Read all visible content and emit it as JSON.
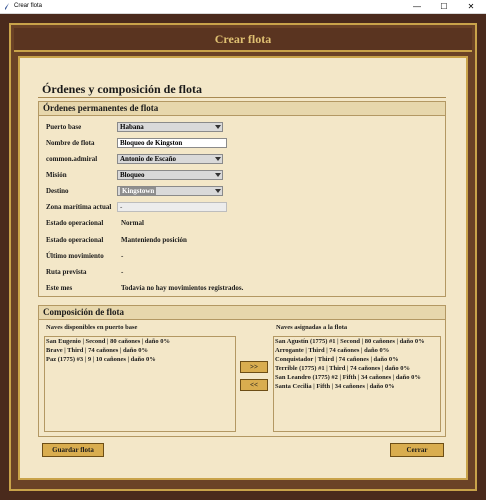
{
  "window": {
    "title": "Crear flota",
    "controls": [
      "—",
      "☐",
      "✕"
    ]
  },
  "header": {
    "title": "Crear flota"
  },
  "main": {
    "title": "Órdenes y composición de flota"
  },
  "orders": {
    "heading": "Órdenes permanentes de flota",
    "fields": {
      "home_port": {
        "label": "Puerto base",
        "value": "Habana"
      },
      "fleet_name": {
        "label": "Nombre de flota",
        "value": "Bloqueo de Kingston"
      },
      "admiral": {
        "label": "common.admiral",
        "value": "Antonio de Escaño"
      },
      "mission": {
        "label": "Misión",
        "value": "Bloqueo"
      },
      "destination": {
        "label": "Destino",
        "value": "Kingstown"
      },
      "current_zone": {
        "label": "Zona marítima actual",
        "value": "-"
      },
      "op_status": {
        "label": "Estado operacional",
        "value": "Normal"
      },
      "op_state": {
        "label": "Estado operacional",
        "value": "Manteniendo posición"
      },
      "last_move": {
        "label": "Último movimiento",
        "value": "-"
      },
      "planned_route": {
        "label": "Ruta prevista",
        "value": "-"
      },
      "this_month": {
        "label": "Este mes",
        "value": "Todavía no hay movimientos registrados."
      }
    }
  },
  "composition": {
    "heading": "Composición de flota",
    "available": {
      "label": "Naves disponibles en puerto base",
      "items": [
        "San Eugenio | Second | 80 cañones | daño 0%",
        "Brave | Third | 74 cañones | daño 0%",
        "Paz (1775) #3 | 9 | 10 cañones | daño 0%"
      ]
    },
    "assigned": {
      "label": "Naves asignadas a la flota",
      "items": [
        "San Agustín (1775) #1 | Second | 80 cañones | daño 0%",
        "Arrogante | Third | 74 cañones | daño 0%",
        "Conquistador | Third | 74 cañones | daño 0%",
        "Terrible (1775) #1 | Third | 74 cañones | daño 0%",
        "San Leandro (1775) #2 | Fifth | 34 cañones | daño 0%",
        "Santa Cecilia | Fifth | 34 cañones | daño 0%"
      ]
    },
    "add_label": ">>",
    "remove_label": "<<"
  },
  "footer": {
    "save_label": "Guardar flota",
    "close_label": "Cerrar"
  },
  "colors": {
    "frame": "#4a2a1c",
    "gold": "#c9a34a",
    "parchment": "#f3e7c8",
    "button": "#d9ad4f"
  }
}
